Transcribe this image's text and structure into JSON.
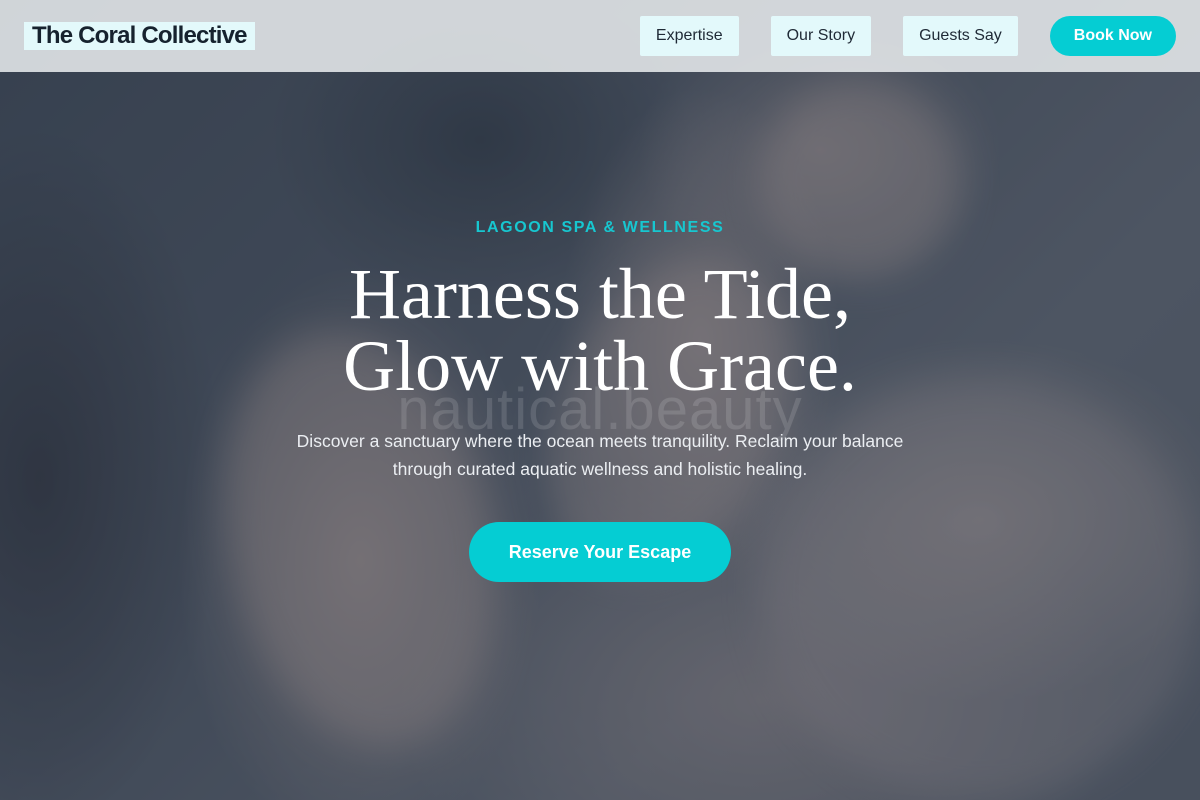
{
  "header": {
    "logo": "The Coral Collective",
    "nav": [
      {
        "label": "Expertise"
      },
      {
        "label": "Our Story"
      },
      {
        "label": "Guests Say"
      }
    ],
    "book_label": "Book Now"
  },
  "hero": {
    "eyebrow": "LAGOON SPA & WELLNESS",
    "headline_line1": "Harness the Tide,",
    "headline_line2": "Glow with Grace.",
    "watermark": "nautical.beauty",
    "subtext_line1": "Discover a sanctuary where the ocean meets tranquility. Reclaim your balance",
    "subtext_line2": "through curated aquatic wellness and holistic healing.",
    "cta_label": "Reserve Your Escape"
  },
  "colors": {
    "accent": "#05cdd3",
    "nav_bg": "#e3f9fb",
    "eyebrow": "#17c7d0"
  }
}
